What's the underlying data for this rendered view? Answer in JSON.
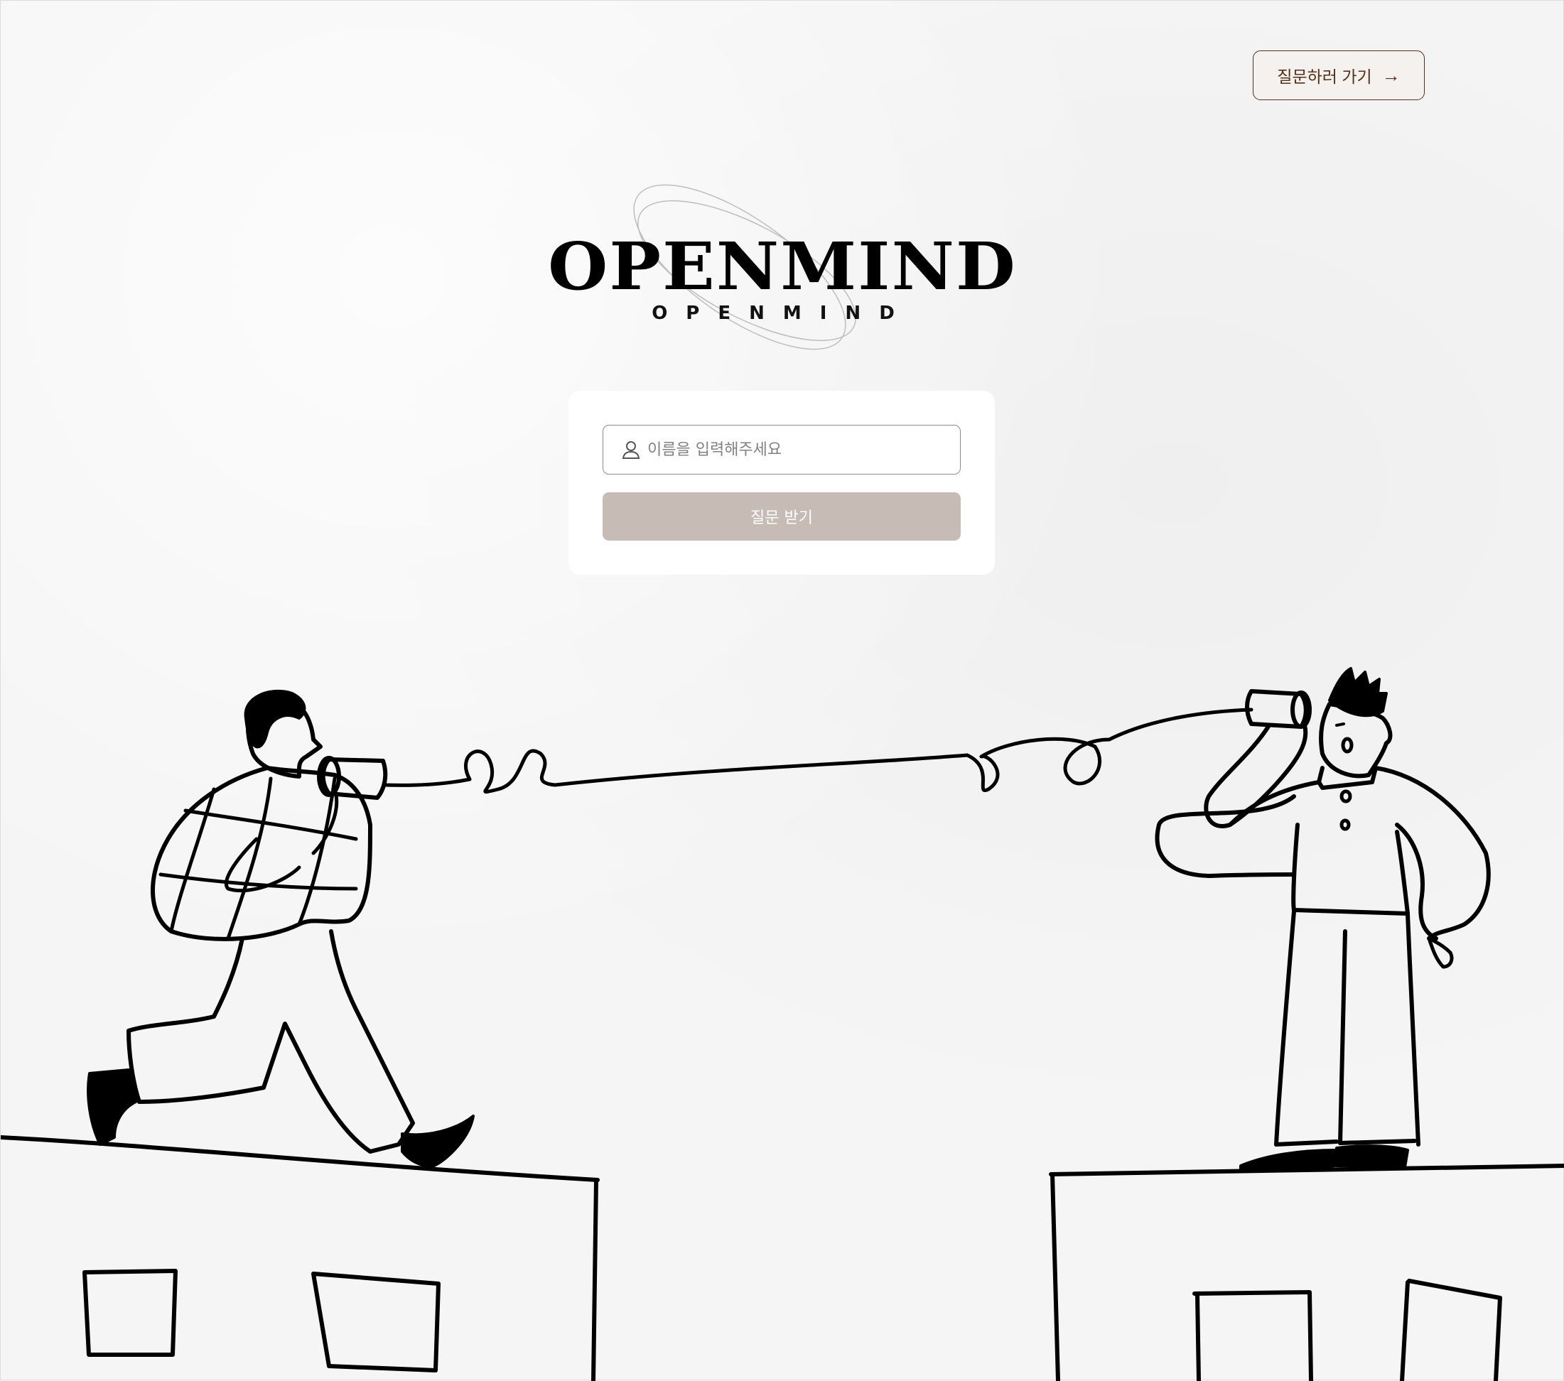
{
  "header": {
    "go_question_label": "질문하러 가기",
    "go_question_arrow": "→"
  },
  "logo": {
    "main_text": "OPENMIND",
    "sub_text": "OPENMIND"
  },
  "form": {
    "name_placeholder": "이름을 입력해주세요",
    "name_value": "",
    "submit_label": "질문 받기"
  },
  "colors": {
    "brand_brown": "#542f1a",
    "button_disabled": "#c7bbb5",
    "background": "#f5f5f5",
    "card": "#ffffff"
  },
  "icons": [
    "arrow-right-icon",
    "user-icon"
  ]
}
